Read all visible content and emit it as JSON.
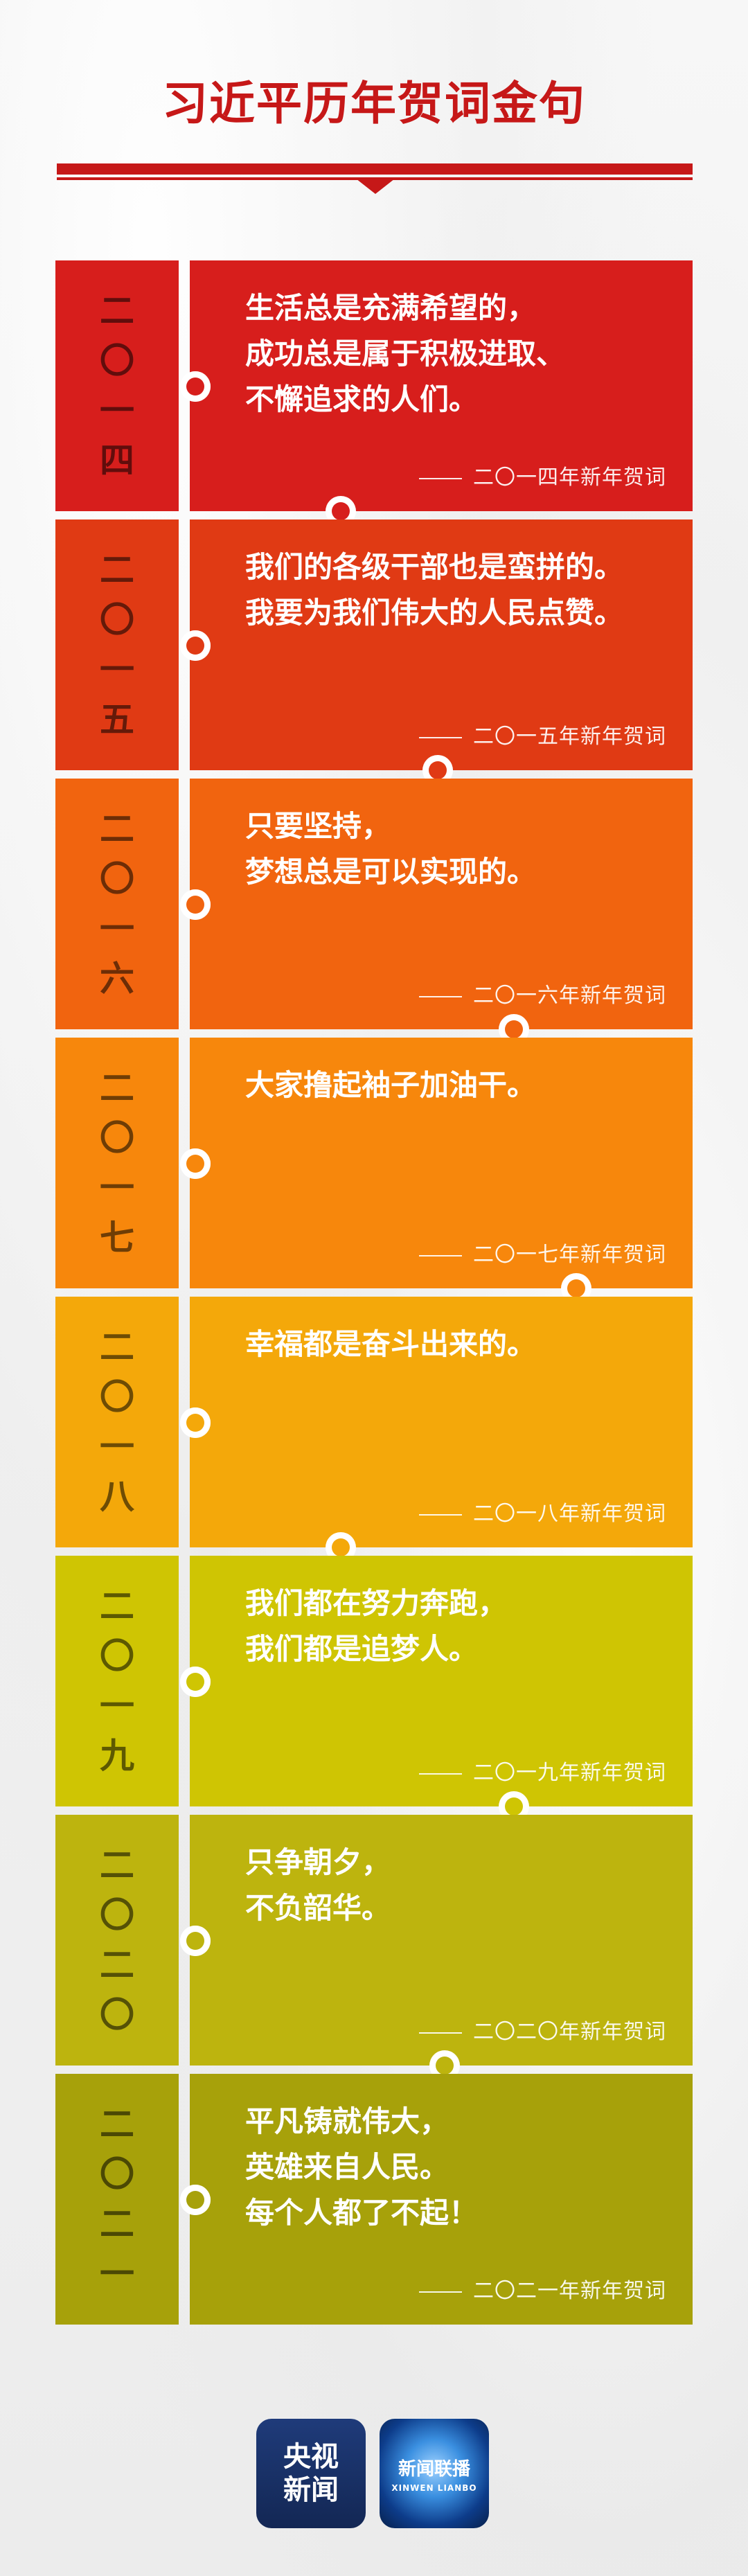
{
  "title": "习近平历年贺词金句",
  "rows": [
    {
      "year": [
        "二",
        "〇",
        "一",
        "四"
      ],
      "quote": "生活总是充满希望的，\n成功总是属于积极进取、\n不懈追求的人们。",
      "source": "二〇一四年新年贺词",
      "color": "#d71e1c"
    },
    {
      "year": [
        "二",
        "〇",
        "一",
        "五"
      ],
      "quote": "我们的各级干部也是蛮拼的。\n我要为我们伟大的人民点赞。",
      "source": "二〇一五年新年贺词",
      "color": "#e03a14"
    },
    {
      "year": [
        "二",
        "〇",
        "一",
        "六"
      ],
      "quote": "只要坚持，\n梦想总是可以实现的。",
      "source": "二〇一六年新年贺词",
      "color": "#f1640f"
    },
    {
      "year": [
        "二",
        "〇",
        "一",
        "七"
      ],
      "quote": "大家撸起袖子加油干。",
      "source": "二〇一七年新年贺词",
      "color": "#f7870c"
    },
    {
      "year": [
        "二",
        "〇",
        "一",
        "八"
      ],
      "quote": "幸福都是奋斗出来的。",
      "source": "二〇一八年新年贺词",
      "color": "#f4a80a"
    },
    {
      "year": [
        "二",
        "〇",
        "一",
        "九"
      ],
      "quote": "我们都在努力奔跑，\n我们都是追梦人。",
      "source": "二〇一九年新年贺词",
      "color": "#cfc503"
    },
    {
      "year": [
        "二",
        "〇",
        "二",
        "〇"
      ],
      "quote": "只争朝夕，\n不负韶华。",
      "source": "二〇二〇年新年贺词",
      "color": "#bdb40e"
    },
    {
      "year": [
        "二",
        "〇",
        "二",
        "一"
      ],
      "quote": "平凡铸就伟大，\n英雄来自人民。\n每个人都了不起！",
      "source": "二〇二一年新年贺词",
      "color": "#a7a10a"
    }
  ],
  "logos": {
    "cctv_line1": "央视",
    "cctv_line2": "新闻",
    "xwlb_text": "新闻联播",
    "xwlb_sub": "XINWEN LIANBO"
  }
}
